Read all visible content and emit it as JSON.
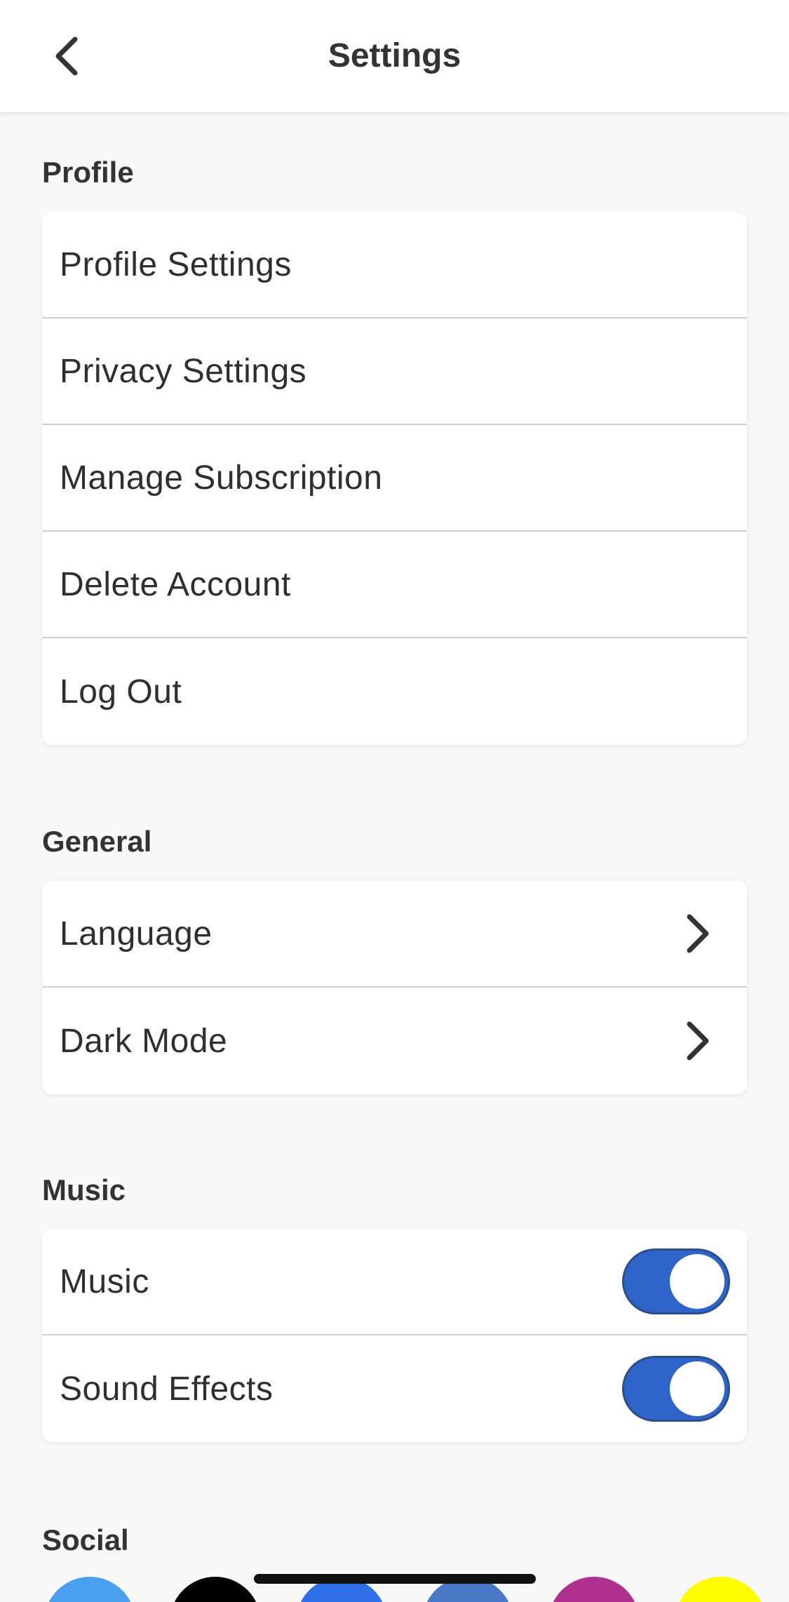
{
  "header": {
    "title": "Settings",
    "back_icon": "chevron-left-icon"
  },
  "profile": {
    "title": "Profile",
    "items": [
      {
        "label": "Profile Settings"
      },
      {
        "label": "Privacy Settings"
      },
      {
        "label": "Manage Subscription"
      },
      {
        "label": "Delete Account"
      },
      {
        "label": "Log Out"
      }
    ]
  },
  "general": {
    "title": "General",
    "items": [
      {
        "label": "Language",
        "icon": "chevron-right-icon"
      },
      {
        "label": "Dark Mode",
        "icon": "chevron-right-icon"
      }
    ]
  },
  "music": {
    "title": "Music",
    "items": [
      {
        "label": "Music",
        "toggle_on": true
      },
      {
        "label": "Sound Effects",
        "toggle_on": true
      }
    ]
  },
  "social": {
    "title": "Social",
    "icons": [
      {
        "name": "twitter-icon",
        "color": "#4a9ff0"
      },
      {
        "name": "tiktok-icon",
        "color": "#000000"
      },
      {
        "name": "facebook-icon",
        "color": "#2f6fe8"
      },
      {
        "name": "linkedin-icon",
        "color": "#4a78c8"
      },
      {
        "name": "instagram-icon",
        "color": "#b0308f"
      },
      {
        "name": "snapchat-icon",
        "color": "#fffc00"
      }
    ]
  },
  "colors": {
    "accent": "#2e63c7",
    "background": "#f8f8f8",
    "card": "#ffffff",
    "divider": "#cfcfcf"
  }
}
